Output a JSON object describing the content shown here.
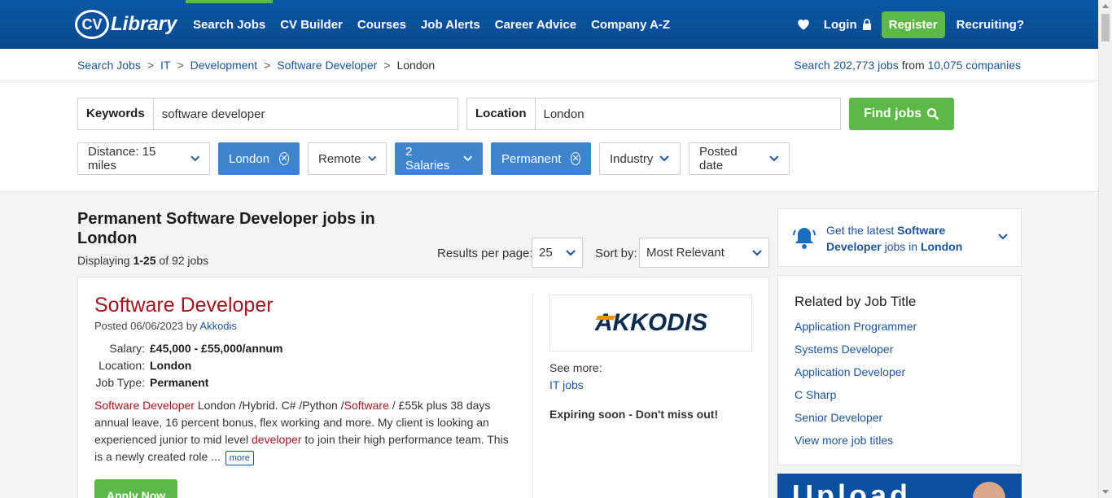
{
  "header": {
    "logo_mark": "CV",
    "logo_text": "Library",
    "nav": [
      "Search Jobs",
      "CV Builder",
      "Courses",
      "Job Alerts",
      "Career Advice",
      "Company A-Z"
    ],
    "login": "Login",
    "register": "Register",
    "recruiting": "Recruiting?"
  },
  "breadcrumb": {
    "items": [
      "Search Jobs",
      "IT",
      "Development",
      "Software Developer"
    ],
    "current": "London",
    "separator": ">"
  },
  "stats": {
    "prefix": "Search",
    "jobs_count": "202,773 jobs",
    "middle": "from",
    "companies_count": "10,075 companies"
  },
  "search": {
    "keywords_label": "Keywords",
    "keywords_value": "software developer",
    "location_label": "Location",
    "location_value": "London",
    "find_button": "Find jobs"
  },
  "filters": {
    "distance": "Distance: 15 miles",
    "location": "London",
    "remote": "Remote",
    "salaries": "2 Salaries",
    "job_type": "Permanent",
    "industry": "Industry",
    "posted_date": "Posted date"
  },
  "results": {
    "title": "Permanent Software Developer jobs in London",
    "displaying_prefix": "Displaying",
    "displaying_range": "1-25",
    "displaying_suffix": "of 92 jobs",
    "per_page_label": "Results per page:",
    "per_page_value": "25",
    "sort_label": "Sort by:",
    "sort_value": "Most Relevant"
  },
  "job": {
    "title": "Software Developer",
    "posted_prefix": "Posted 06/06/2023 by",
    "company": "Akkodis",
    "salary_label": "Salary:",
    "salary": "£45,000 - £55,000/annum",
    "location_label": "Location:",
    "location": "London",
    "type_label": "Job Type:",
    "type": "Permanent",
    "desc_hl1": "Software Developer",
    "desc_1": " London /Hybrid. C# /Python /",
    "desc_hl2": "Software",
    "desc_2": " / £55k plus 38 days annual leave, 16 percent bonus, flex working and more. My client is looking an experienced junior to mid level ",
    "desc_hl3": "developer",
    "desc_3": " to join their high performance team. This is a newly created role ...",
    "more": "more",
    "apply": "Apply Now",
    "logo_text": "AKKODIS",
    "see_more": "See more:",
    "see_more_link": "IT jobs",
    "expiring": "Expiring soon - Don't miss out!"
  },
  "alert": {
    "prefix": "Get the latest",
    "strong1": "Software Developer",
    "middle": "jobs in",
    "strong2": "London"
  },
  "related": {
    "title": "Related by Job Title",
    "items": [
      "Application Programmer",
      "Systems Developer",
      "Application Developer",
      "C Sharp",
      "Senior Developer",
      "View more job titles"
    ]
  },
  "ad": {
    "text": "Upload"
  },
  "colors": {
    "brand_blue": "#0b57a4",
    "accent_green": "#5cb847",
    "job_red": "#a0161f",
    "chip_blue": "#3d84cc"
  }
}
